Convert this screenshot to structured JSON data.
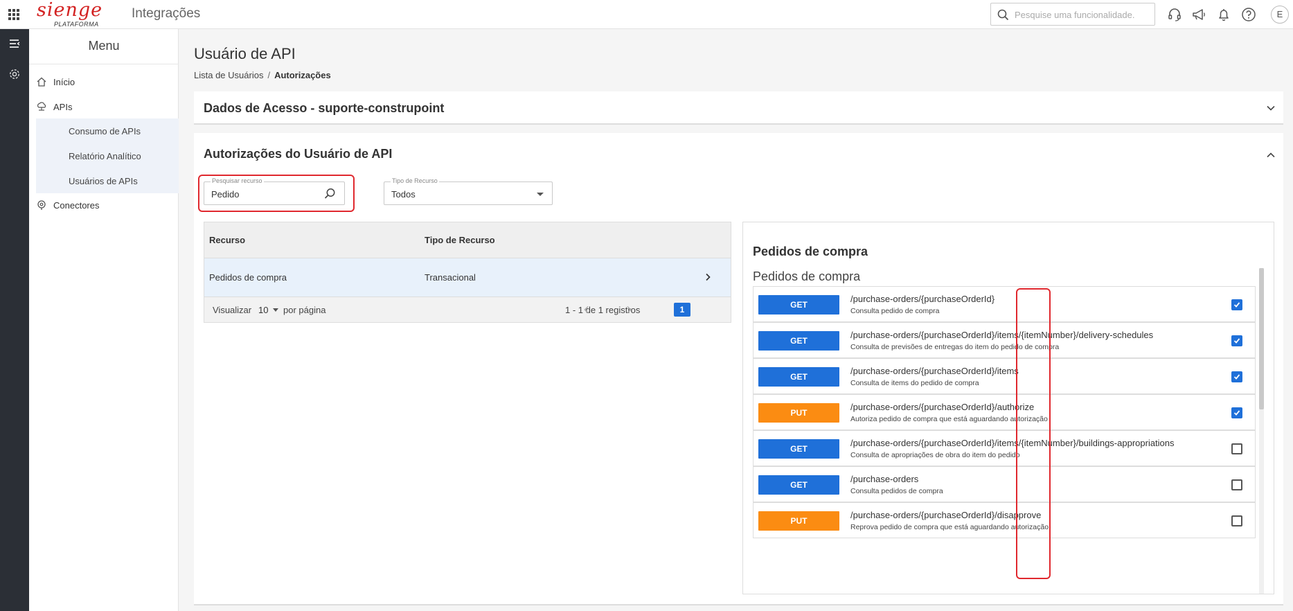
{
  "header": {
    "logo_text": "sienge",
    "logo_sub": "PLATAFORMA",
    "module_title": "Integrações",
    "search_placeholder": "Pesquise uma funcionalidade.",
    "avatar_initial": "E"
  },
  "sidebar": {
    "title": "Menu",
    "items": [
      {
        "label": "Início"
      },
      {
        "label": "APIs"
      },
      {
        "label": "Consumo de APIs"
      },
      {
        "label": "Relatório Analítico"
      },
      {
        "label": "Usuários de APIs"
      },
      {
        "label": "Conectores"
      }
    ]
  },
  "main": {
    "page_title": "Usuário de API",
    "breadcrumb": {
      "link": "Lista de Usuários",
      "separator": "/",
      "current": "Autorizações"
    },
    "access_panel_title": "Dados de Acesso - suporte-construpoint",
    "auth_panel_title": "Autorizações do Usuário de API",
    "filters": {
      "search_label": "Pesquisar recurso",
      "search_value": "Pedido",
      "type_label": "Tipo de Recurso",
      "type_value": "Todos"
    },
    "table": {
      "columns": [
        "Recurso",
        "Tipo de Recurso"
      ],
      "rows": [
        {
          "resource": "Pedidos de compra",
          "type": "Transacional"
        }
      ],
      "footer": {
        "show_label": "Visualizar",
        "per_page_value": "10",
        "per_page_suffix": "por página",
        "range_text": "1 - 1 de 1 registros",
        "current_page": "1"
      }
    },
    "resource_detail": {
      "title": "Pedidos de compra",
      "subtitle": "Pedidos de compra",
      "endpoints": [
        {
          "method": "GET",
          "path": "/purchase-orders/{purchaseOrderId}",
          "description": "Consulta pedido de compra",
          "checked": true
        },
        {
          "method": "GET",
          "path": "/purchase-orders/{purchaseOrderId}/items/{itemNumber}/delivery-schedules",
          "description": "Consulta de previsões de entregas do item do pedido de compra",
          "checked": true
        },
        {
          "method": "GET",
          "path": "/purchase-orders/{purchaseOrderId}/items",
          "description": "Consulta de items do pedido de compra",
          "checked": true
        },
        {
          "method": "PUT",
          "path": "/purchase-orders/{purchaseOrderId}/authorize",
          "description": "Autoriza pedido de compra que está aguardando autorização",
          "checked": true
        },
        {
          "method": "GET",
          "path": "/purchase-orders/{purchaseOrderId}/items/{itemNumber}/buildings-appropriations",
          "description": "Consulta de apropriações de obra do item do pedido",
          "checked": false
        },
        {
          "method": "GET",
          "path": "/purchase-orders",
          "description": "Consulta pedidos de compra",
          "checked": false
        },
        {
          "method": "PUT",
          "path": "/purchase-orders/{purchaseOrderId}/disapprove",
          "description": "Reprova pedido de compra que está aguardando autorização",
          "checked": false
        }
      ]
    }
  },
  "colors": {
    "accent": "#1f70d9",
    "put": "#fb8c12",
    "highlight": "#e0282e",
    "logo": "#d32222",
    "rail": "#2b2f36"
  }
}
